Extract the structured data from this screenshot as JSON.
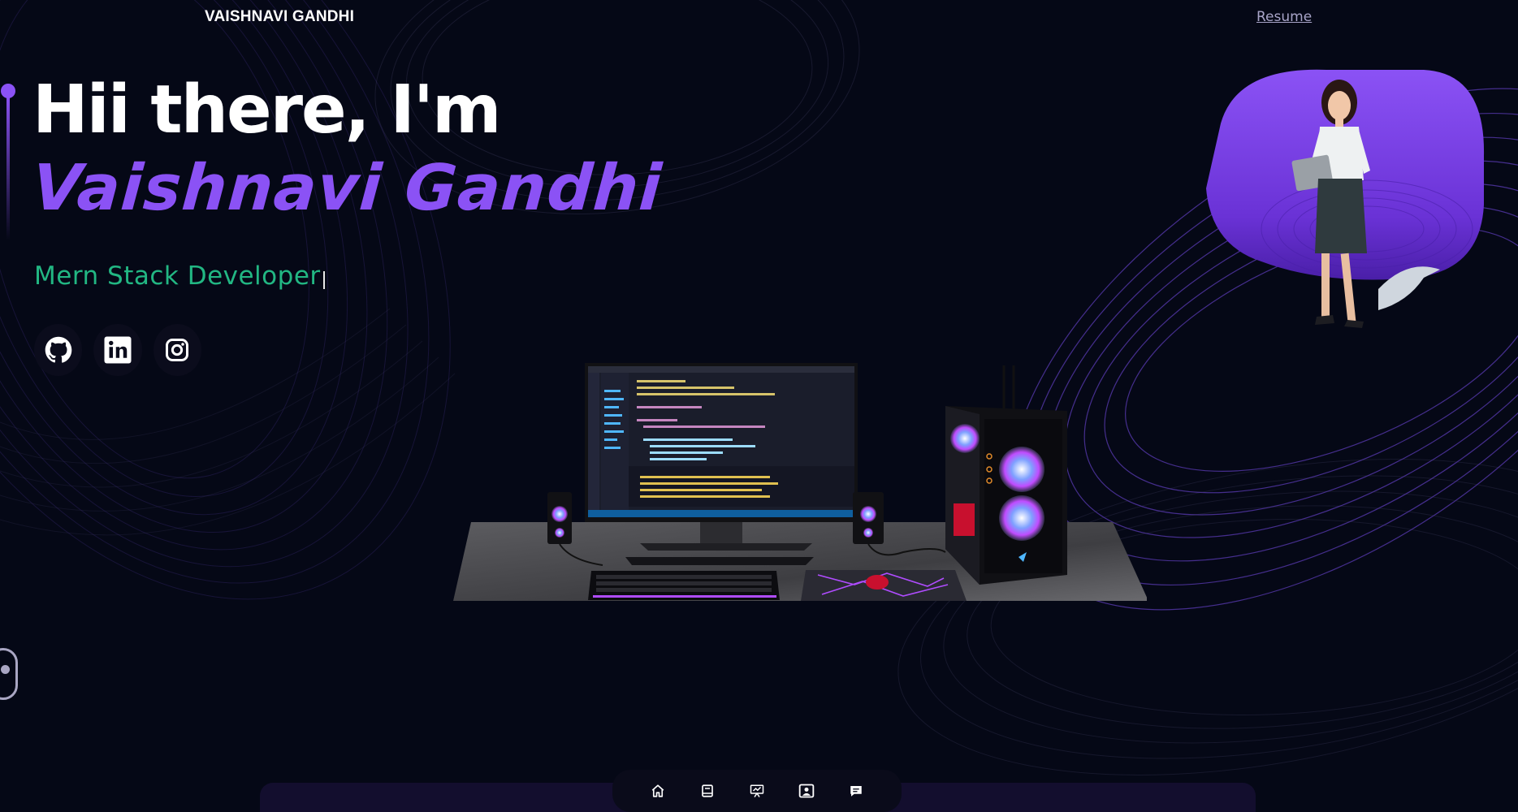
{
  "header": {
    "brand": "VAISHNAVI GANDHI",
    "resume_label": "Resume"
  },
  "hero": {
    "greeting": "Hii there, I'm",
    "name": "Vaishnavi  Gandhi",
    "role": "Mern Stack Developer"
  },
  "socials": [
    {
      "icon": "github-icon"
    },
    {
      "icon": "linkedin-icon"
    },
    {
      "icon": "instagram-icon"
    }
  ],
  "dock": [
    {
      "icon": "home-icon"
    },
    {
      "icon": "book-icon"
    },
    {
      "icon": "presentation-icon"
    },
    {
      "icon": "contact-card-icon"
    },
    {
      "icon": "chat-icon"
    }
  ],
  "colors": {
    "background": "#050816",
    "accent_purple": "#8b52f5",
    "role_green": "#22b783",
    "text_white": "#ffffff",
    "link_muted": "#a8a4c8"
  }
}
